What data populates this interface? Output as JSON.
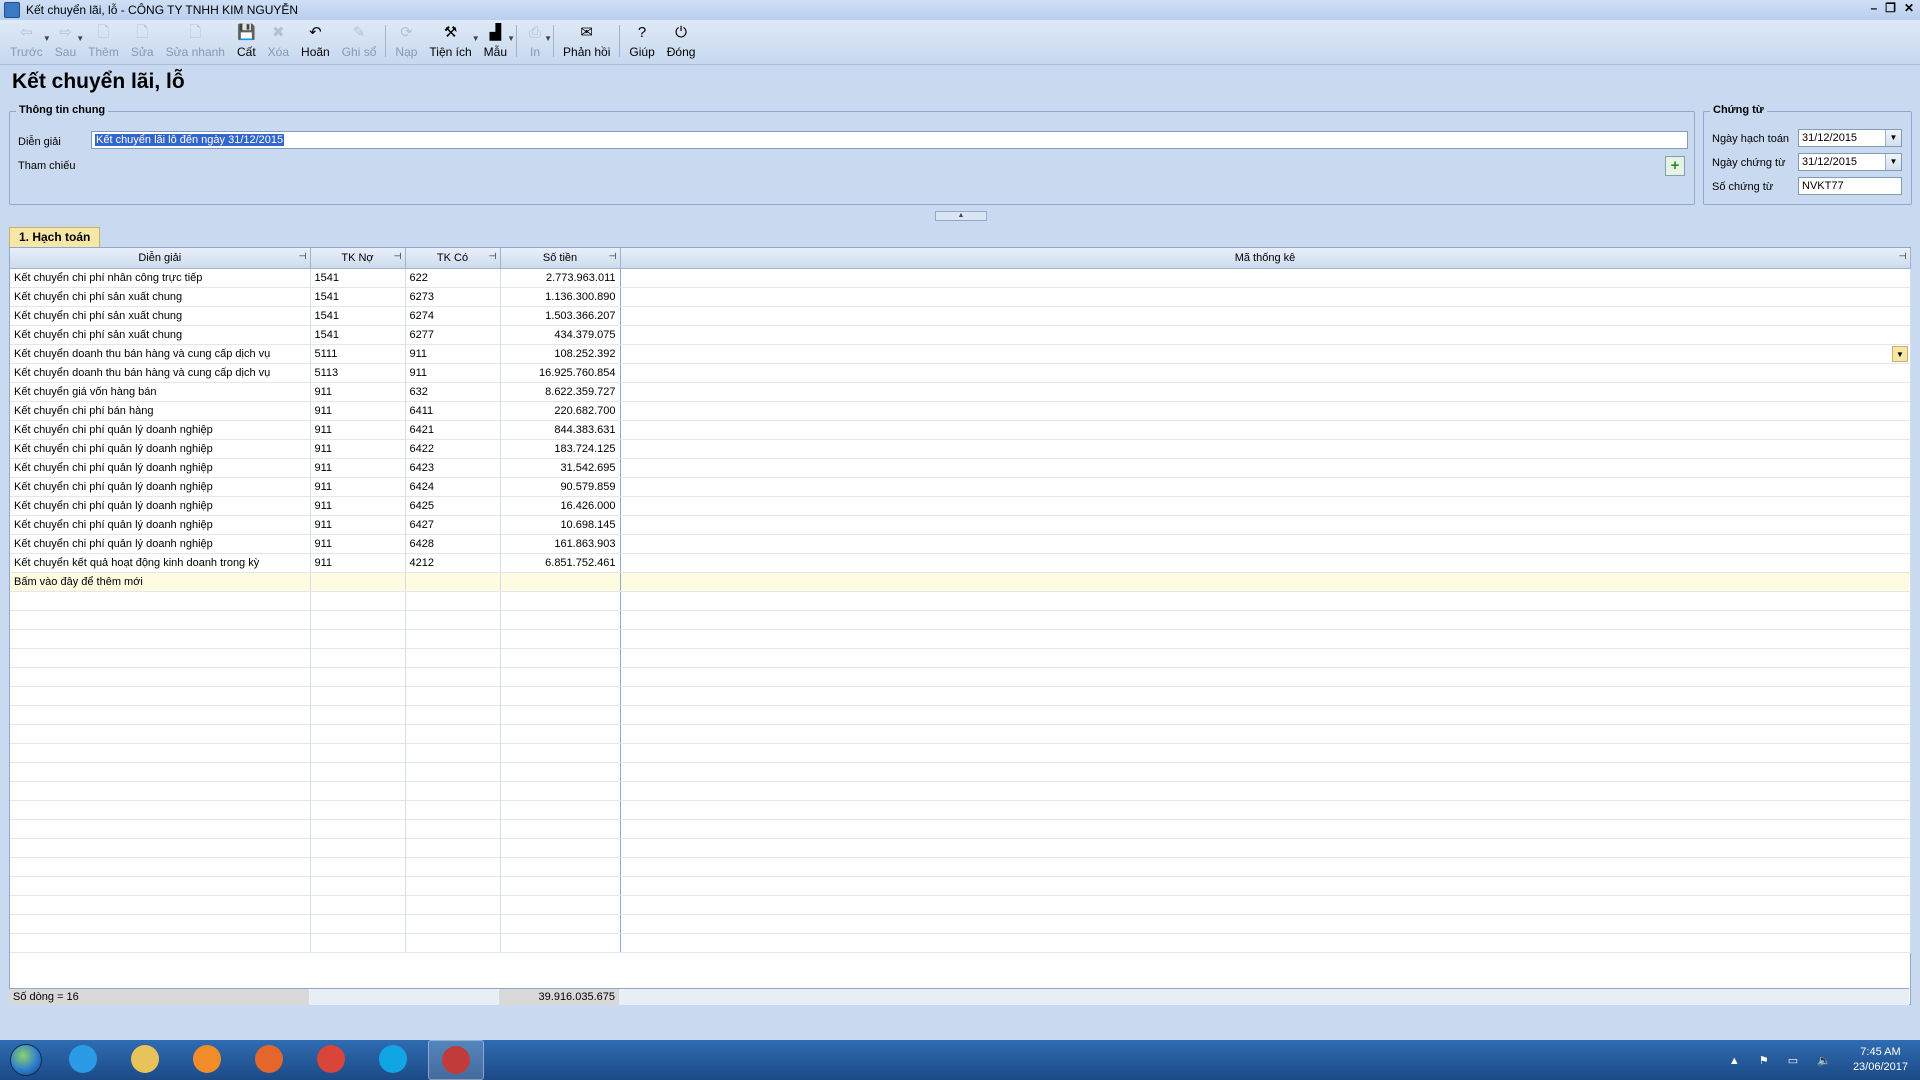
{
  "window": {
    "title": "Kết chuyển lãi, lỗ - CÔNG TY TNHH KIM NGUYỄN",
    "controls": [
      "–",
      "❐",
      "✕"
    ]
  },
  "toolbar": [
    {
      "id": "prev",
      "label": "Trước",
      "icon": "arrow-left-icon",
      "glyph": "⇦",
      "enabled": false,
      "dropdown": true
    },
    {
      "id": "next",
      "label": "Sau",
      "icon": "arrow-right-icon",
      "glyph": "⇨",
      "enabled": false,
      "dropdown": true
    },
    {
      "id": "add",
      "label": "Thêm",
      "icon": "add-document-icon",
      "glyph": "🗋",
      "enabled": false
    },
    {
      "id": "edit",
      "label": "Sửa",
      "icon": "edit-document-icon",
      "glyph": "🗋",
      "enabled": false
    },
    {
      "id": "quickedit",
      "label": "Sửa nhanh",
      "icon": "quick-edit-icon",
      "glyph": "🗋",
      "enabled": false
    },
    {
      "id": "save",
      "label": "Cất",
      "icon": "save-icon",
      "glyph": "💾",
      "enabled": true
    },
    {
      "id": "delete",
      "label": "Xóa",
      "icon": "delete-icon",
      "glyph": "✖",
      "enabled": false
    },
    {
      "id": "undo",
      "label": "Hoãn",
      "icon": "undo-icon",
      "glyph": "↶",
      "enabled": true
    },
    {
      "id": "post",
      "label": "Ghi sổ",
      "icon": "pencil-icon",
      "glyph": "✎",
      "enabled": false
    },
    {
      "id": "load",
      "label": "Nạp",
      "icon": "reload-icon",
      "glyph": "⟳",
      "enabled": false
    },
    {
      "id": "utility",
      "label": "Tiện ích",
      "icon": "utility-icon",
      "glyph": "⚒",
      "enabled": true,
      "dropdown": true
    },
    {
      "id": "template",
      "label": "Mẫu",
      "icon": "template-chart-icon",
      "glyph": "▟",
      "enabled": true,
      "dropdown": true
    },
    {
      "id": "print",
      "label": "In",
      "icon": "print-icon",
      "glyph": "⎙",
      "enabled": false,
      "dropdown": true
    },
    {
      "id": "feedback",
      "label": "Phản hồi",
      "icon": "mail-icon",
      "glyph": "✉",
      "enabled": true
    },
    {
      "id": "help",
      "label": "Giúp",
      "icon": "help-icon",
      "glyph": "?",
      "enabled": true
    },
    {
      "id": "close",
      "label": "Đóng",
      "icon": "close-icon",
      "glyph": "⏻",
      "enabled": true
    }
  ],
  "page": {
    "title": "Kết chuyển lãi, lỗ"
  },
  "general": {
    "title": "Thông tin chung",
    "desc_label": "Diễn giải",
    "desc_value": "Kết chuyển lãi lỗ đến ngày 31/12/2015",
    "ref_label": "Tham chiếu"
  },
  "voucher": {
    "title": "Chứng từ",
    "posting_date_label": "Ngày hạch toán",
    "posting_date": "31/12/2015",
    "voucher_date_label": "Ngày chứng từ",
    "voucher_date": "31/12/2015",
    "voucher_no_label": "Số chứng từ",
    "voucher_no": "NVKT77"
  },
  "tab": {
    "label": "1. Hạch toán"
  },
  "grid": {
    "columns": [
      "Diễn giải",
      "TK Nợ",
      "TK Có",
      "Số tiền",
      "Mã thống kê"
    ],
    "rows": [
      [
        "Kết chuyển chi phí nhân công trực tiếp",
        "1541",
        "622",
        "2.773.963.011"
      ],
      [
        "Kết chuyển chi phí sản xuất chung",
        "1541",
        "6273",
        "1.136.300.890"
      ],
      [
        "Kết chuyển chi phí sản xuất chung",
        "1541",
        "6274",
        "1.503.366.207"
      ],
      [
        "Kết chuyển chi phí sản xuất chung",
        "1541",
        "6277",
        "434.379.075"
      ],
      [
        "Kết chuyển doanh thu bán hàng và cung cấp dịch vụ",
        "5111",
        "911",
        "108.252.392"
      ],
      [
        "Kết chuyển doanh thu bán hàng và cung cấp dịch vụ",
        "5113",
        "911",
        "16.925.760.854"
      ],
      [
        "Kết chuyển giá vốn hàng bán",
        "911",
        "632",
        "8.622.359.727"
      ],
      [
        "Kết chuyển chi phí bán hàng",
        "911",
        "6411",
        "220.682.700"
      ],
      [
        "Kết chuyển chi phí quản lý doanh nghiệp",
        "911",
        "6421",
        "844.383.631"
      ],
      [
        "Kết chuyển chi phí quản lý doanh nghiệp",
        "911",
        "6422",
        "183.724.125"
      ],
      [
        "Kết chuyển chi phí quản lý doanh nghiệp",
        "911",
        "6423",
        "31.542.695"
      ],
      [
        "Kết chuyển chi phí quản lý doanh nghiệp",
        "911",
        "6424",
        "90.579.859"
      ],
      [
        "Kết chuyển chi phí quản lý doanh nghiệp",
        "911",
        "6425",
        "16.426.000"
      ],
      [
        "Kết chuyển chi phí quản lý doanh nghiệp",
        "911",
        "6427",
        "10.698.145"
      ],
      [
        "Kết chuyển chi phí quản lý doanh nghiệp",
        "911",
        "6428",
        "161.863.903"
      ],
      [
        "Kết chuyển kết quả hoạt động kinh doanh trong kỳ",
        "911",
        "4212",
        "6.851.752.461"
      ]
    ],
    "new_row_label": "Bấm vào đây để thêm mới",
    "footer_count": "Số dòng = 16",
    "footer_total": "39.916.035.675"
  },
  "taskbar": {
    "apps": [
      {
        "name": "internet-explorer-icon",
        "color": "#2b9be6"
      },
      {
        "name": "file-explorer-icon",
        "color": "#e8c25a"
      },
      {
        "name": "media-player-icon",
        "color": "#f08c2a"
      },
      {
        "name": "firefox-icon",
        "color": "#e5662a"
      },
      {
        "name": "chrome-icon",
        "color": "#d9453b"
      },
      {
        "name": "skype-icon",
        "color": "#12a5e6"
      },
      {
        "name": "accounting-app-icon",
        "color": "#c23b3b"
      }
    ],
    "time": "7:45 AM",
    "date": "23/06/2017"
  }
}
